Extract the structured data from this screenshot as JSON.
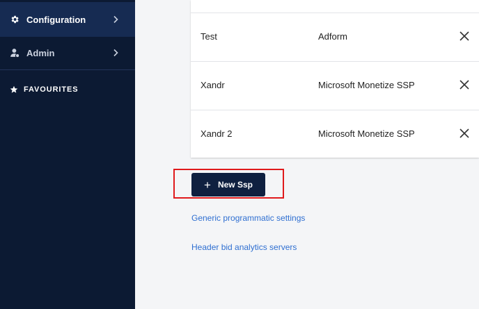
{
  "sidebar": {
    "items": [
      {
        "label": "Configuration",
        "icon": "gear-icon",
        "active": true
      },
      {
        "label": "Admin",
        "icon": "admin-icon",
        "active": false
      }
    ],
    "favourites_label": "FAVOURITES"
  },
  "ssp_table": {
    "rows": [
      {
        "name": "Test",
        "type": "Adform"
      },
      {
        "name": "Xandr",
        "type": "Microsoft Monetize SSP"
      },
      {
        "name": "Xandr 2",
        "type": "Microsoft Monetize SSP"
      }
    ]
  },
  "actions": {
    "new_ssp_label": "New Ssp",
    "plus": "+"
  },
  "links": {
    "generic_settings": "Generic programmatic settings",
    "header_bid": "Header bid analytics servers"
  },
  "colors": {
    "sidebar_bg": "#0c1a33",
    "sidebar_active": "#162b52",
    "primary_button": "#0f2040",
    "link": "#2f6fd1",
    "highlight_border": "#e0191b"
  }
}
